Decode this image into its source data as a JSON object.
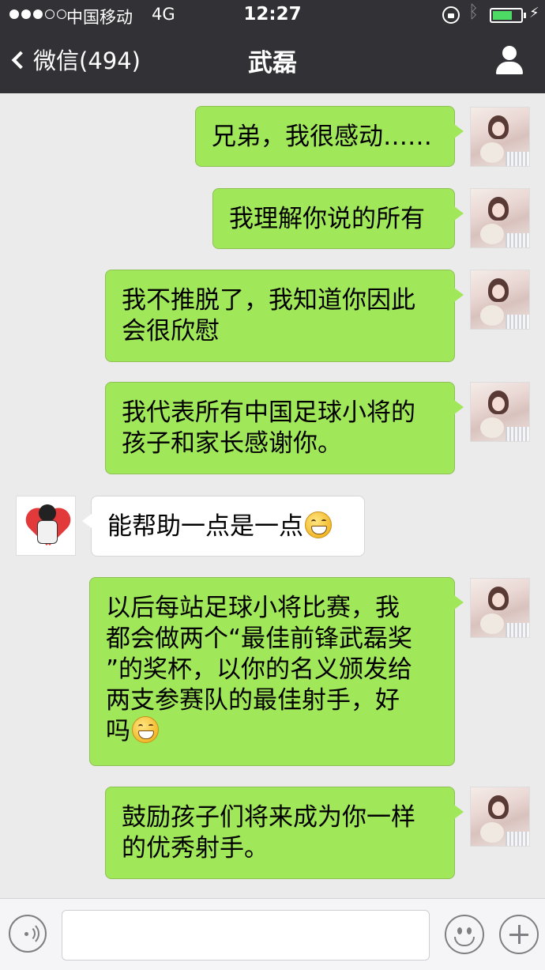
{
  "status_bar": {
    "carrier": "中国移动",
    "network": "4G",
    "time": "12:27",
    "signal_bars_filled": 3,
    "signal_bars_total": 5,
    "battery_level": 0.7,
    "icons": [
      "signal-dots-icon",
      "orientation-lock-icon",
      "bluetooth-icon",
      "battery-icon",
      "charging-bolt-icon"
    ]
  },
  "nav": {
    "back_label": "微信(494)",
    "title": "武磊",
    "profile_icon": "person-icon"
  },
  "messages": [
    {
      "side": "me",
      "lines": [
        "兄弟，我很感动……"
      ]
    },
    {
      "side": "me",
      "lines": [
        "我理解你说的所有"
      ]
    },
    {
      "side": "me",
      "lines": [
        "我不推脱了，我知道你因此",
        "会很欣慰"
      ]
    },
    {
      "side": "me",
      "lines": [
        "我代表所有中国足球小将的",
        "孩子和家长感谢你。"
      ]
    },
    {
      "side": "them",
      "lines": [
        "能帮助一点是一点"
      ],
      "emoji": "grin-emoji"
    },
    {
      "side": "me",
      "lines": [
        "以后每站足球小将比赛，我",
        "都会做两个“最佳前锋武磊奖",
        "”的奖杯，以你的名义颁发给",
        "两支参赛队的最佳射手，好",
        "吗"
      ],
      "emoji": "grin-emoji"
    },
    {
      "side": "me",
      "lines": [
        "鼓励孩子们将来成为你一样",
        "的优秀射手。"
      ]
    }
  ],
  "input_bar": {
    "placeholder": "",
    "icons": [
      "voice-icon",
      "emoji-face-icon",
      "plus-icon"
    ]
  }
}
